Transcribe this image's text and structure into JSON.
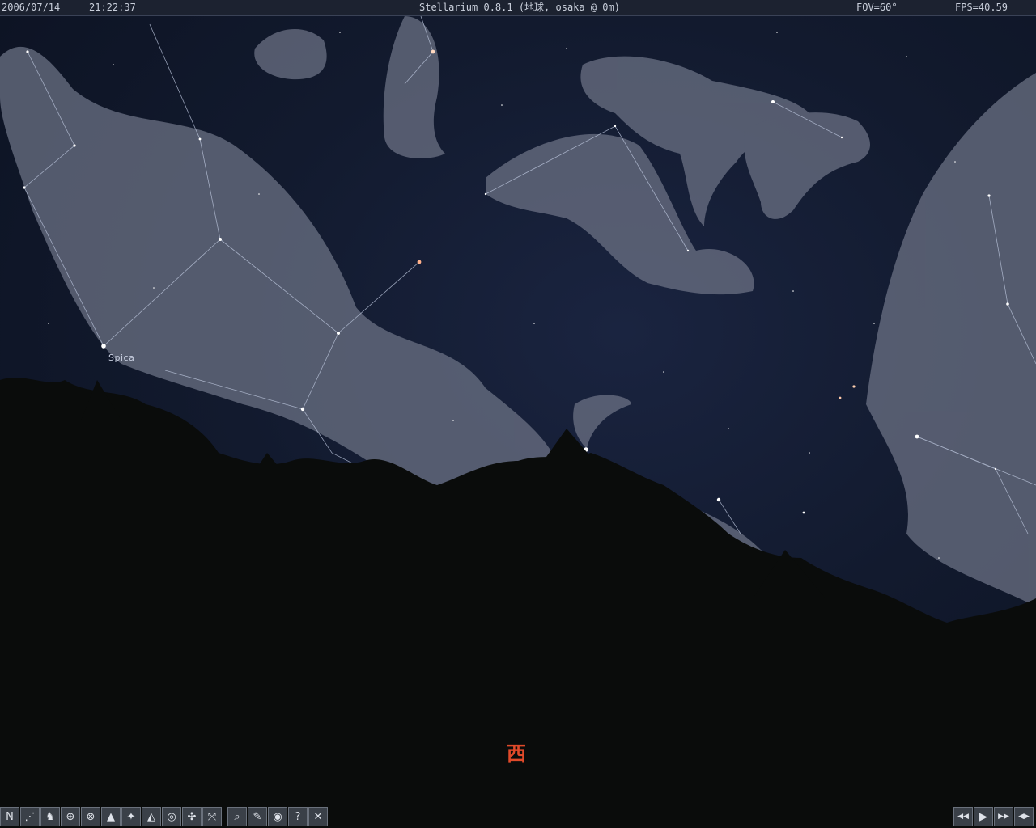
{
  "app": {
    "date": "2006/07/14",
    "time": "21:22:37",
    "title": "Stellarium 0.8.1 (地球, osaka @ 0m)",
    "fov": "FOV=60°",
    "fps": "FPS=40.59"
  },
  "sky": {
    "star_labels": [
      {
        "name": "Spica"
      }
    ],
    "cardinal_label": "西"
  },
  "toolbar": {
    "buttons": [
      {
        "icon": "constellation-lines-icon",
        "glyph": "N"
      },
      {
        "icon": "constellation-names-icon",
        "glyph": "⋰"
      },
      {
        "icon": "constellation-art-icon",
        "glyph": "♞"
      },
      {
        "icon": "azimuth-grid-icon",
        "glyph": "⊕"
      },
      {
        "icon": "equatorial-grid-icon",
        "glyph": "⊗"
      },
      {
        "icon": "ground-icon",
        "glyph": "▲"
      },
      {
        "icon": "cardinal-points-icon",
        "glyph": "✦"
      },
      {
        "icon": "atmosphere-icon",
        "glyph": "◭"
      },
      {
        "icon": "nebulas-icon",
        "glyph": "◎"
      },
      {
        "icon": "planets-icon",
        "glyph": "✣"
      },
      {
        "icon": "equatorial-mount-icon",
        "glyph": "⤧"
      },
      {
        "icon": "search-icon",
        "glyph": "⌕"
      },
      {
        "icon": "configuration-icon",
        "glyph": "✎"
      },
      {
        "icon": "night-mode-icon",
        "glyph": "◉"
      },
      {
        "icon": "help-icon",
        "glyph": "?"
      },
      {
        "icon": "quit-icon",
        "glyph": "✕"
      }
    ],
    "time_controls": [
      {
        "icon": "rewind-icon",
        "glyph": "◀◀"
      },
      {
        "icon": "play-icon",
        "glyph": "▶"
      },
      {
        "icon": "fast-forward-icon",
        "glyph": "▶▶"
      },
      {
        "icon": "real-time-icon",
        "glyph": "◀▶"
      }
    ]
  }
}
